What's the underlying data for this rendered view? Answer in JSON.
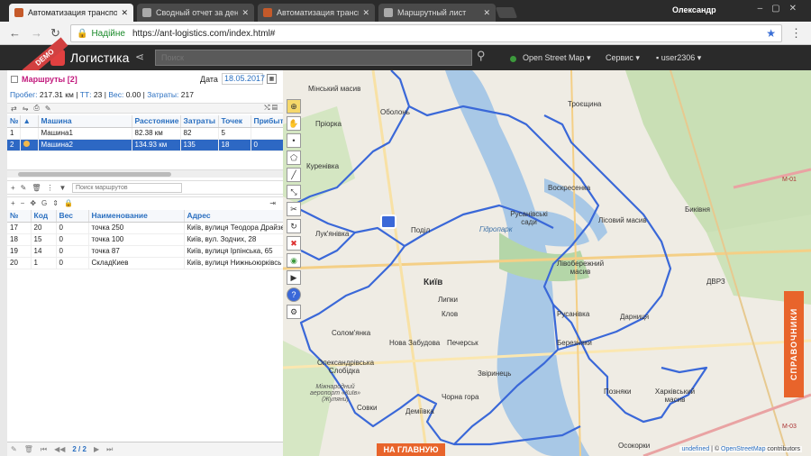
{
  "browser": {
    "tabs": [
      {
        "title": "Автоматизация транспо",
        "icon_color": "#c55a2a"
      },
      {
        "title": "Сводный отчет за день",
        "icon_color": "#aaaaaa"
      },
      {
        "title": "Автоматизация транспо",
        "icon_color": "#c55a2a"
      },
      {
        "title": "Маршрутный лист",
        "icon_color": "#aaaaaa"
      }
    ],
    "user": "Олександр",
    "security_label": "Надійне",
    "url": "https://ant-logistics.com/index.html#"
  },
  "app": {
    "badge": "DEMO",
    "title": "Логистика",
    "search_placeholder": "Поиск",
    "map_layer": "Open Street Map",
    "service_menu": "Сервис",
    "user": "user2306"
  },
  "routes": {
    "title": "Маршруты [2]",
    "date_label": "Дата",
    "date_value": "18.05.2017",
    "summary": {
      "mileage_label": "Пробег:",
      "mileage": "217.31 км",
      "tt_label": "ТТ:",
      "tt": "23",
      "weight_label": "Вес:",
      "weight": "0.00",
      "cost_label": "Затраты:",
      "cost": "217"
    },
    "columns": [
      "№",
      "▲",
      "Машина",
      "Расстояние",
      "Затраты",
      "Точек",
      "Прибыт"
    ],
    "rows": [
      {
        "num": "1",
        "car": "Машина1",
        "distance": "82.38 км",
        "cost": "82",
        "points": "5",
        "arrival": ""
      },
      {
        "num": "2",
        "car": "Машина2",
        "distance": "134.93 км",
        "cost": "135",
        "points": "18",
        "arrival": "0"
      }
    ],
    "filter_placeholder": "Поиск маршрутов"
  },
  "points": {
    "columns": [
      "№",
      "Код",
      "Вес",
      "Наименование",
      "Адрес"
    ],
    "rows": [
      {
        "num": "17",
        "code": "20",
        "weight": "0",
        "name": "точка 250",
        "address": "Київ, вулиця Теодора Драйзе"
      },
      {
        "num": "18",
        "code": "15",
        "weight": "0",
        "name": "точка 100",
        "address": "Київ, вул. Зодчих, 28"
      },
      {
        "num": "19",
        "code": "14",
        "weight": "0",
        "name": "точка 87",
        "address": "Київ, вулиця Ірпінська, 65"
      },
      {
        "num": "20",
        "code": "1",
        "weight": "0",
        "name": "СкладКиев",
        "address": "Київ, вулиця Нижньоюрківсь"
      }
    ],
    "pager": "2 / 2"
  },
  "map": {
    "labels": {
      "minsk": "Мінський масив",
      "obolon": "Оболонь",
      "priorka": "Пріорка",
      "troieshchyna": "Троєщина",
      "kurenivka": "Куренівка",
      "voskresenka": "Воскресенка",
      "rusanivski": "Русанівські сади",
      "lisovyi": "Лісовий масив",
      "bykivnia": "Биківня",
      "lukianivka": "Лук'янівка",
      "podil": "Поділ",
      "hidropark": "Гідропарк",
      "kyiv": "Київ",
      "lypky": "Липки",
      "klov": "Клов",
      "livoberezhnyi": "Лівобережний масив",
      "dvrz": "ДВРЗ",
      "rusanivka": "Русанівка",
      "darnytsia": "Дарниця",
      "solomianka": "Солом'янка",
      "nova_zabudova": "Нова Забудова",
      "pecherskyi": "Печерськ",
      "berezniaky": "Березняки",
      "oleksandrivska": "Олександрівська Слобідка",
      "airport": "Міжнародний аеропорт «Київ» (Жуляни)",
      "zvirynets": "Звіринець",
      "chorna_hora": "Чорна гора",
      "pozniaky": "Позняки",
      "kharkivskyi": "Харківський масив",
      "sovky": "Совки",
      "demiivka": "Деміївка",
      "osokorky": "Осокорки",
      "m01": "М-01",
      "m03": "М-03"
    },
    "sidebar_tab": "СПРАВОЧНИКИ",
    "home_button": "НА ГЛАВНУЮ",
    "attribution_prefix": "undefined",
    "attribution_sep": " | © ",
    "attribution_link": "OpenStreetMap",
    "attribution_suffix": " contributors",
    "route_color": "#3a68d8"
  }
}
